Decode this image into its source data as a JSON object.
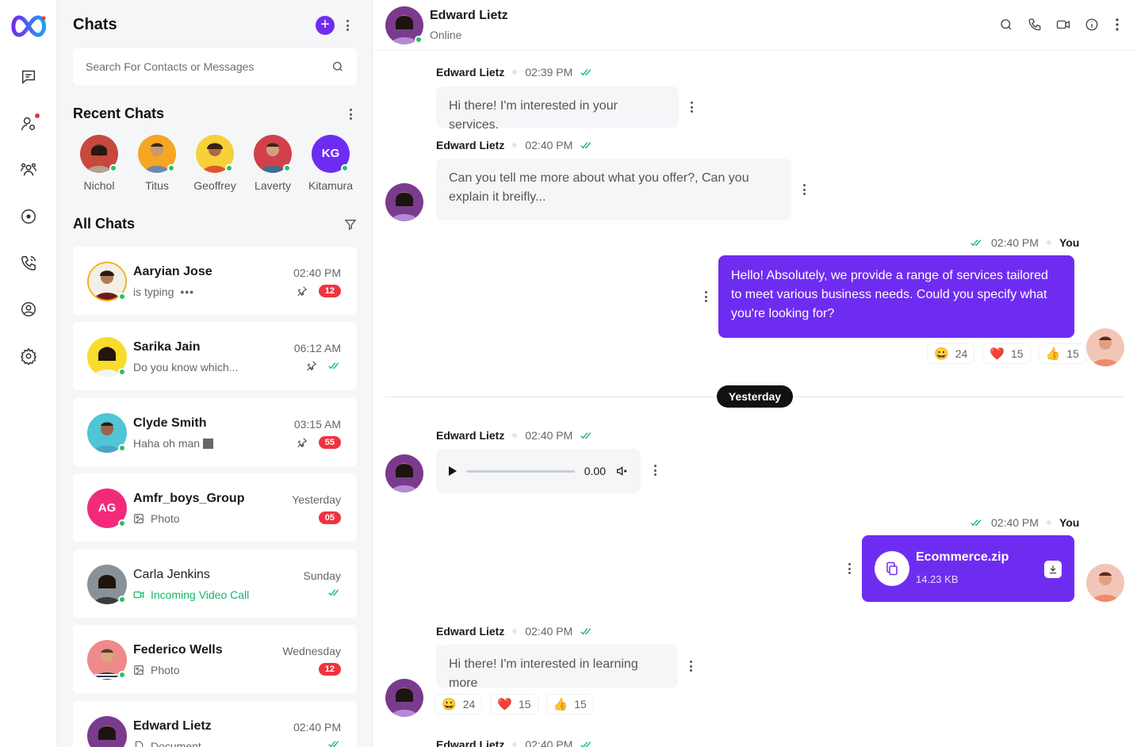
{
  "sidebar": {
    "title": "Chats",
    "search_placeholder": "Search For Contacts or Messages",
    "recent_title": "Recent Chats",
    "recent": [
      {
        "name": "Nichol"
      },
      {
        "name": "Titus"
      },
      {
        "name": "Geoffrey"
      },
      {
        "name": "Laverty"
      },
      {
        "name": "Kitamura",
        "initials": "KG"
      }
    ],
    "all_title": "All Chats",
    "chats": [
      {
        "name": "Aaryian Jose",
        "message": "is typing",
        "time": "02:40 PM",
        "badge": "12"
      },
      {
        "name": "Sarika Jain",
        "message": "Do you know which...",
        "time": "06:12 AM"
      },
      {
        "name": "Clyde Smith",
        "message": "Haha oh man",
        "time": "03:15 AM",
        "badge": "55"
      },
      {
        "name": "Amfr_boys_Group",
        "initials": "AG",
        "message": "Photo",
        "time": "Yesterday",
        "badge": "05"
      },
      {
        "name": "Carla Jenkins",
        "message": "Incoming Video Call",
        "time": "Sunday"
      },
      {
        "name": "Federico Wells",
        "message": "Photo",
        "time": "Wednesday",
        "badge": "12"
      },
      {
        "name": "Edward Lietz",
        "message": "Document",
        "time": "02:40 PM"
      }
    ]
  },
  "chat": {
    "contact": "Edward Lietz",
    "status": "Online",
    "messages": [
      {
        "sender": "Edward Lietz",
        "time": "02:39 PM",
        "text": "Hi there! I'm interested in your services."
      },
      {
        "sender": "Edward Lietz",
        "time": "02:40 PM",
        "text": "Can you tell me more about what you offer?, Can you explain it breifly..."
      },
      {
        "sender": "You",
        "time": "02:40 PM",
        "text": "Hello! Absolutely, we provide a range of services tailored to meet various business needs. Could you specify what you're looking for?",
        "reactions": [
          {
            "emoji": "😀",
            "count": "24"
          },
          {
            "emoji": "❤️",
            "count": "15"
          },
          {
            "emoji": "👍",
            "count": "15"
          }
        ]
      },
      {
        "sender": "Edward Lietz",
        "time": "02:40 PM",
        "audio_time": "0.00"
      },
      {
        "sender": "You",
        "time": "02:40 PM",
        "file_name": "Ecommerce.zip",
        "file_size": "14.23 KB"
      },
      {
        "sender": "Edward Lietz",
        "time": "02:40 PM",
        "text": "Hi there! I'm interested in learning more",
        "reactions": [
          {
            "emoji": "😀",
            "count": "24"
          },
          {
            "emoji": "❤️",
            "count": "15"
          },
          {
            "emoji": "👍",
            "count": "15"
          }
        ]
      },
      {
        "sender": "Edward Lietz",
        "time": "02:40 PM"
      }
    ],
    "day_divider": "Yesterday"
  },
  "colors": {
    "accent": "#6f2cf1",
    "badge": "#ef3340",
    "online": "#22c55e",
    "read_tick": "#12b76a",
    "group_avatar": "#f32a7a"
  },
  "icons": {
    "rail": [
      "chat-icon",
      "contacts-icon",
      "group-icon",
      "status-icon",
      "calls-icon",
      "profile-icon",
      "settings-icon"
    ],
    "header": [
      "search-icon",
      "phone-icon",
      "video-icon",
      "info-icon",
      "more-icon"
    ]
  }
}
